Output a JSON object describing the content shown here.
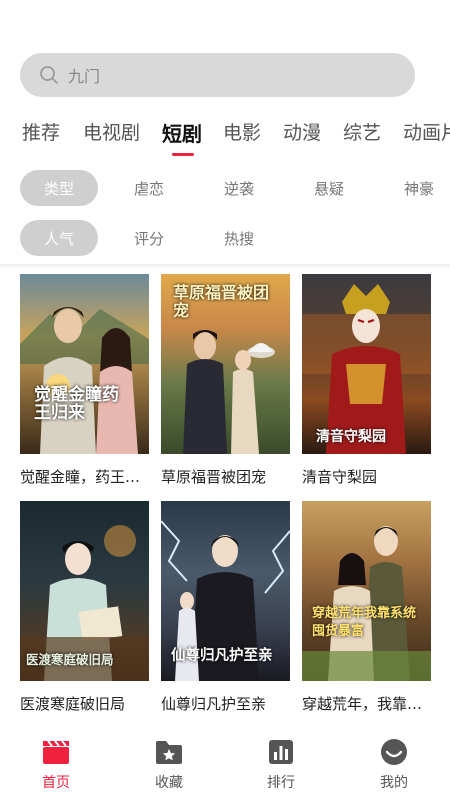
{
  "search": {
    "placeholder": "九门"
  },
  "tabs": [
    {
      "label": "推荐"
    },
    {
      "label": "电视剧"
    },
    {
      "label": "短剧"
    },
    {
      "label": "电影"
    },
    {
      "label": "动漫"
    },
    {
      "label": "综艺"
    },
    {
      "label": "动画片"
    }
  ],
  "active_tab": "短剧",
  "filters": {
    "row1": [
      "类型",
      "虐恋",
      "逆袭",
      "悬疑",
      "神豪"
    ],
    "row2": [
      "人气",
      "评分",
      "热搜"
    ]
  },
  "cards": [
    {
      "title": "觉醒金瞳，药王归来",
      "poster_text": "觉醒金瞳药王归来"
    },
    {
      "title": "草原福晋被团宠",
      "poster_text": "草原福晋被团宠"
    },
    {
      "title": "清音守梨园",
      "poster_text": "清音守梨园"
    },
    {
      "title": "医渡寒庭破旧局",
      "poster_text": "医渡寒庭破旧局"
    },
    {
      "title": "仙尊归凡护至亲",
      "poster_text": "仙尊归凡护至亲"
    },
    {
      "title": "穿越荒年，我靠系统囤货暴富",
      "poster_text": "穿越荒年我靠系统囤货暴富"
    }
  ],
  "nav": [
    {
      "label": "首页",
      "icon": "clapperboard-icon"
    },
    {
      "label": "收藏",
      "icon": "folder-star-icon"
    },
    {
      "label": "排行",
      "icon": "bar-chart-icon"
    },
    {
      "label": "我的",
      "icon": "user-face-icon"
    }
  ],
  "colors": {
    "accent": "#f0203e",
    "chip_active": "#cfcfcf",
    "search_bg": "#d9d9d9"
  }
}
